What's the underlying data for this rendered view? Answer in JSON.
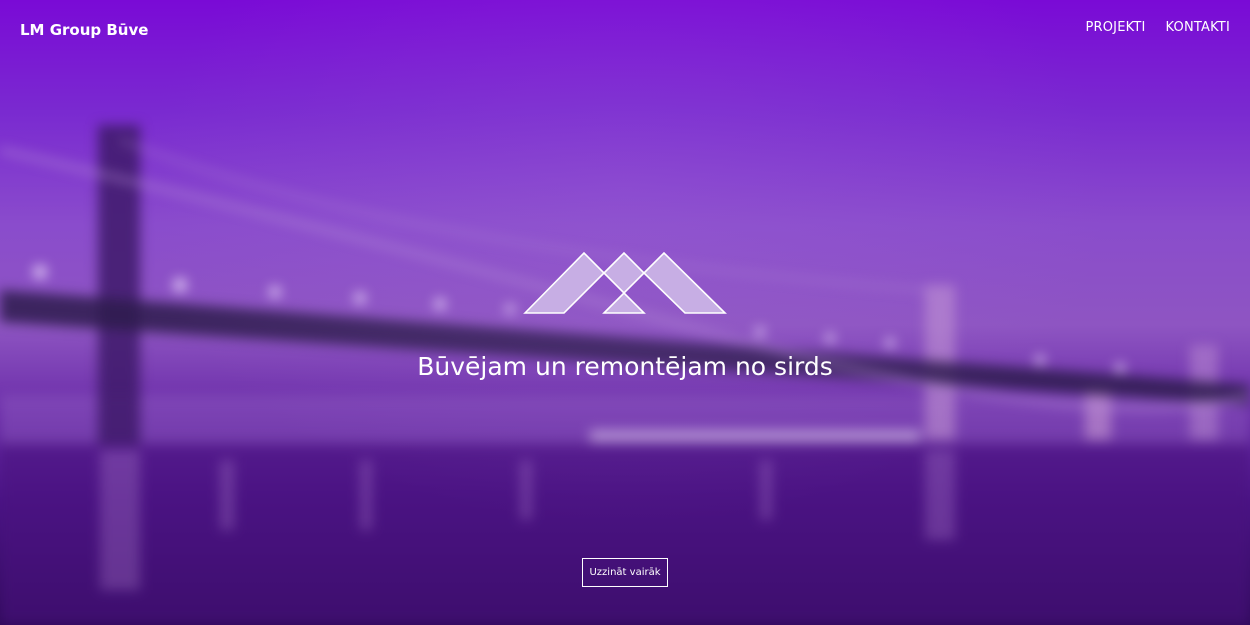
{
  "header": {
    "brand": "LM Group Būve",
    "nav": [
      {
        "label": "PROJEKTI"
      },
      {
        "label": "KONTAKTI"
      }
    ]
  },
  "hero": {
    "tagline": "Būvējam un remontējam no sirds",
    "cta_label": "Uzzināt vairāk",
    "logo_icon": "mountains-logo-icon",
    "background": "blurred-bridge-background"
  },
  "colors": {
    "primary": "#7a0ad6",
    "text": "#ffffff"
  }
}
